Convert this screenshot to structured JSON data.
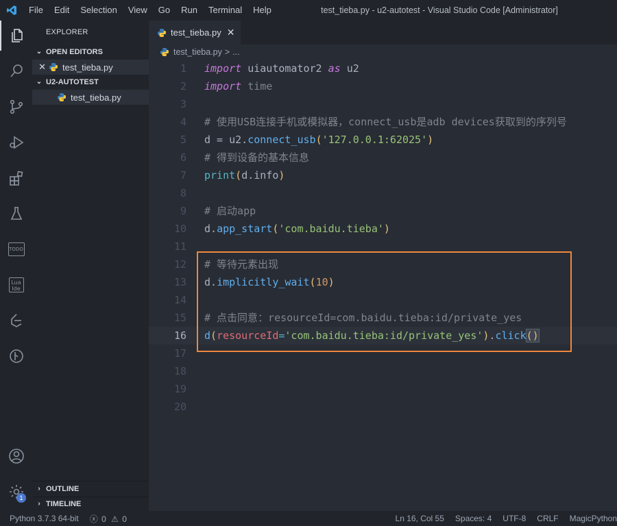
{
  "titlebar": {
    "menus": [
      "File",
      "Edit",
      "Selection",
      "View",
      "Go",
      "Run",
      "Terminal",
      "Help"
    ],
    "window_title": "test_tieba.py - u2-autotest - Visual Studio Code [Administrator]"
  },
  "activity_bar": {
    "icons": [
      "explorer-icon",
      "search-icon",
      "source-control-icon",
      "run-debug-icon",
      "extensions-icon",
      "testing-icon",
      "todo-icon",
      "lua-ide-icon",
      "remote-icon",
      "git-graph-icon",
      "account-icon",
      "manage-gear-icon"
    ],
    "todo_label": "TODO",
    "lua_label_1": "Lua",
    "lua_label_2": "Ide",
    "manage_badge": "1"
  },
  "sidebar": {
    "title": "EXPLORER",
    "open_editors_label": "OPEN EDITORS",
    "open_editors_file": "test_tieba.py",
    "folder_label": "U2-AUTOTEST",
    "folder_file": "test_tieba.py",
    "outline_label": "OUTLINE",
    "timeline_label": "TIMELINE"
  },
  "editor": {
    "tab_label": "test_tieba.py",
    "breadcrumb_file": "test_tieba.py",
    "breadcrumb_sep": ">",
    "breadcrumb_more": "...",
    "line_numbers": [
      "1",
      "2",
      "3",
      "4",
      "5",
      "6",
      "7",
      "8",
      "9",
      "10",
      "11",
      "12",
      "13",
      "14",
      "15",
      "16",
      "17",
      "18",
      "19",
      "20"
    ],
    "code": {
      "l1_kw": "import",
      "l1_mod": " uiautomator2 ",
      "l1_as": "as",
      "l1_alias": " u2",
      "l2_kw": "import",
      "l2_mod": " time",
      "l4": "# 使用USB连接手机或模拟器，connect_usb是adb devices获取到的序列号",
      "l5_a": "d = u2.",
      "l5_fn": "connect_usb",
      "l5_p1": "(",
      "l5_str": "'127.0.0.1:62025'",
      "l5_p2": ")",
      "l6": "# 得到设备的基本信息",
      "l7_fn": "print",
      "l7_p1": "(",
      "l7_arg": "d.info",
      "l7_p2": ")",
      "l9": "# 启动app",
      "l10_a": "d.",
      "l10_fn": "app_start",
      "l10_p1": "(",
      "l10_str": "'com.baidu.tieba'",
      "l10_p2": ")",
      "l12": "# 等待元素出现",
      "l13_a": "d.",
      "l13_fn": "implicitly_wait",
      "l13_p1": "(",
      "l13_num": "10",
      "l13_p2": ")",
      "l15": "# 点击同意：resourceId=com.baidu.tieba:id/private_yes",
      "l16_fn": "d",
      "l16_p1": "(",
      "l16_attr": "resourceId",
      "l16_eq": "=",
      "l16_str": "'com.baidu.tieba:id/private_yes'",
      "l16_p2": ")",
      "l16_dot": ".",
      "l16_fn2": "click",
      "l16_p3": "()"
    }
  },
  "statusbar": {
    "python": "Python 3.7.3 64-bit",
    "errors": "0",
    "warnings": "0",
    "position": "Ln 16, Col 55",
    "spaces": "Spaces: 4",
    "encoding": "UTF-8",
    "eol": "CRLF",
    "extension": "MagicPython"
  },
  "colors": {
    "accent_box": "#f0883e",
    "badge": "#4d78cc"
  }
}
